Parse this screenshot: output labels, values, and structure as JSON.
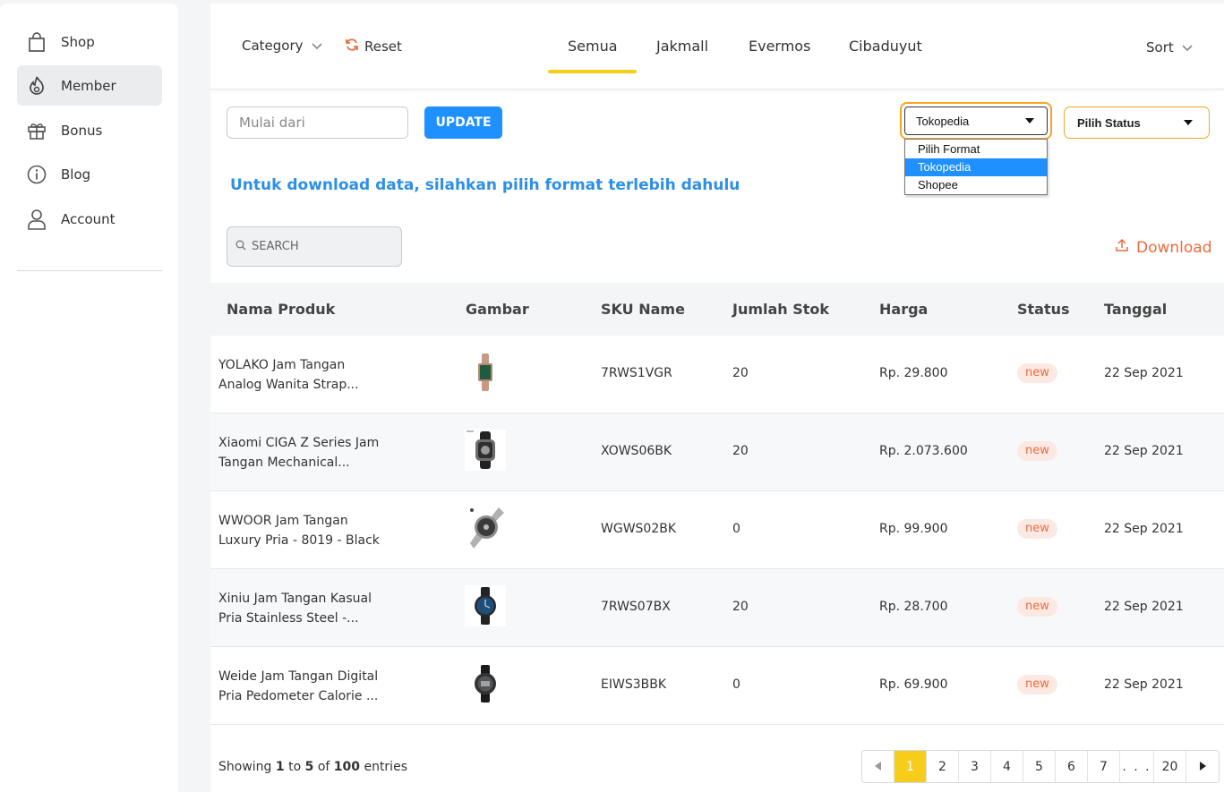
{
  "sidebar": {
    "items": [
      {
        "label": "Shop",
        "icon": "shopping-bag-icon"
      },
      {
        "label": "Member",
        "icon": "fire-icon",
        "active": true
      },
      {
        "label": "Bonus",
        "icon": "gift-icon"
      },
      {
        "label": "Blog",
        "icon": "info-icon"
      },
      {
        "label": "Account",
        "icon": "user-icon"
      }
    ]
  },
  "topbar": {
    "category_label": "Category",
    "reset_label": "Reset",
    "tabs": [
      "Semua",
      "Jakmall",
      "Evermos",
      "Cibaduyut"
    ],
    "active_tab": "Semua",
    "sort_label": "Sort"
  },
  "filters": {
    "date_placeholder": "Mulai dari",
    "update_label": "UPDATE",
    "format_selected": "Tokopedia",
    "format_options": [
      "Pilih Format",
      "Tokopedia",
      "Shopee"
    ],
    "status_selected": "Pilih Status"
  },
  "info_message": "Untuk download data, silahkan pilih format terlebih dahulu",
  "search": {
    "placeholder": "SEARCH"
  },
  "download_label": "Download",
  "table": {
    "headers": [
      "Nama Produk",
      "Gambar",
      "SKU Name",
      "Jumlah Stok",
      "Harga",
      "Status",
      "Tanggal"
    ],
    "rows": [
      {
        "name1": "YOLAKO Jam Tangan",
        "name2": "Analog Wanita Strap...",
        "sku": "7RWS1VGR",
        "stock": "20",
        "price": "Rp. 29.800",
        "status": "new",
        "date": "22 Sep 2021"
      },
      {
        "name1": "Xiaomi CIGA Z Series Jam",
        "name2": "Tangan Mechanical...",
        "sku": "XOWS06BK",
        "stock": "20",
        "price": "Rp. 2.073.600",
        "status": "new",
        "date": "22 Sep 2021"
      },
      {
        "name1": "WWOOR Jam Tangan",
        "name2": "Luxury Pria - 8019 - Black",
        "sku": "WGWS02BK",
        "stock": "0",
        "price": "Rp. 99.900",
        "status": "new",
        "date": "22 Sep 2021"
      },
      {
        "name1": "Xiniu Jam Tangan Kasual",
        "name2": "Pria Stainless Steel -...",
        "sku": "7RWS07BX",
        "stock": "20",
        "price": "Rp. 28.700",
        "status": "new",
        "date": "22 Sep 2021"
      },
      {
        "name1": "Weide Jam Tangan Digital",
        "name2": "Pria Pedometer Calorie ...",
        "sku": "EIWS3BBK",
        "stock": "0",
        "price": "Rp. 69.900",
        "status": "new",
        "date": "22 Sep 2021"
      }
    ]
  },
  "pagination": {
    "showing_prefix": "Showing",
    "from": "1",
    "to_word": "to",
    "to": "5",
    "of_word": "of",
    "total": "100",
    "entries_word": "entries",
    "pages": [
      "1",
      "2",
      "3",
      "4",
      "5",
      "6",
      "7",
      ". . .",
      "20"
    ],
    "current": "1"
  },
  "colors": {
    "accent_yellow": "#f5cd1a",
    "primary_blue": "#1e90ff",
    "download_orange": "#f06a3a",
    "select_border": "#f5a623"
  }
}
